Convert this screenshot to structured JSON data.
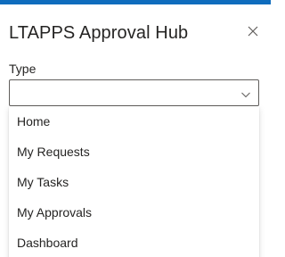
{
  "panel": {
    "title": "LTAPPS Approval Hub",
    "accent_color": "#0f6cbd",
    "close_icon": "close-icon"
  },
  "type_field": {
    "label": "Type",
    "value": "",
    "chevron_icon": "chevron-down-icon",
    "options": [
      "Home",
      "My Requests",
      "My Tasks",
      "My Approvals",
      "Dashboard"
    ]
  }
}
